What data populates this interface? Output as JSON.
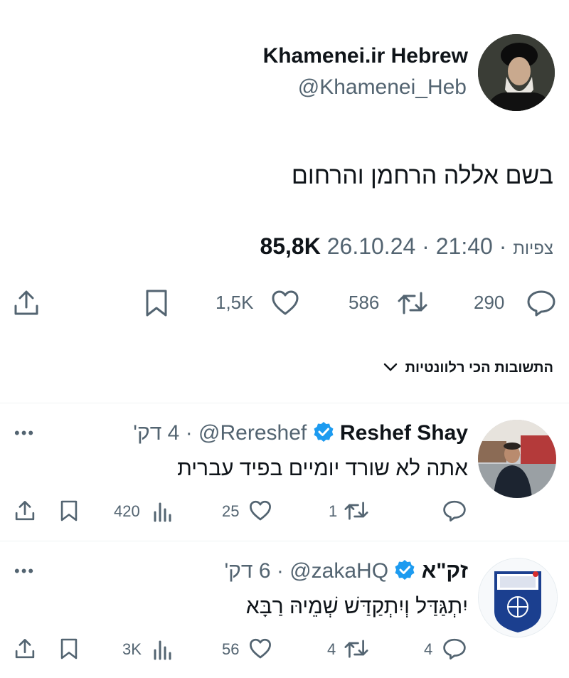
{
  "tweet": {
    "author_name": "Khamenei.ir Hebrew",
    "author_handle": "@Khamenei_Heb",
    "text": "בשם אללה הרחמן והרחום",
    "date": "26.10.24",
    "time": "21:40",
    "views_label": "צפיות",
    "views_count": "85,8K",
    "sep": "·",
    "stats": {
      "replies": "290",
      "retweets": "586",
      "likes": "1,5K"
    }
  },
  "filter": {
    "label": "התשובות הכי רלוונטיות"
  },
  "replies": [
    {
      "name": "Reshef Shay",
      "handle": "@Rereshef",
      "time": "4 דק'",
      "text": "אתה לא שורד יומיים בפיד עברית",
      "views": "420",
      "likes": "25",
      "retweets": "1",
      "replies": ""
    },
    {
      "name": "זק\"א",
      "handle": "@zakaHQ",
      "time": "6 דק'",
      "text": "יִתְגַּדַּל וְיִתְקַדַּשׁ שְׁמֵיהּ רַבָּא",
      "views": "3K",
      "likes": "56",
      "retweets": "4",
      "replies": "4"
    }
  ],
  "colors": {
    "accent": "#1d9bf0",
    "text": "#0f1419",
    "muted": "#536471"
  }
}
